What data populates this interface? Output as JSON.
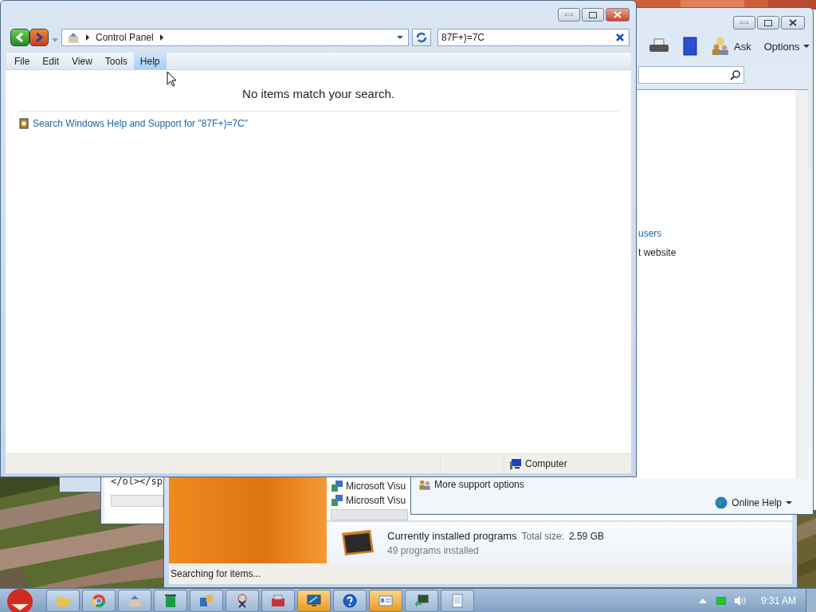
{
  "main_window": {
    "address": [
      "Control Panel"
    ],
    "search_value": "87F+)=7C",
    "menu": [
      {
        "label": "File",
        "selected": false
      },
      {
        "label": "Edit",
        "selected": false
      },
      {
        "label": "View",
        "selected": false
      },
      {
        "label": "Tools",
        "selected": false
      },
      {
        "label": "Help",
        "selected": true
      }
    ],
    "message": "No items match your search.",
    "help_link": "Search Windows Help and Support for \"87F+)=7C\"",
    "status": "Computer"
  },
  "help_window": {
    "toolbar": [
      "Ask",
      "Options"
    ],
    "links": [
      {
        "text": "users",
        "kind": "link"
      },
      {
        "text": "t website",
        "kind": "plain"
      }
    ],
    "more_support": "More support options",
    "online_help": "Online Help"
  },
  "code_window": {
    "lines": [
      "</ol></sp"
    ]
  },
  "programs_window": {
    "list": [
      "Microsoft Visu",
      "Microsoft Visu"
    ],
    "title": "Currently installed programs",
    "size_label": "Total size:",
    "size_value": "2.59 GB",
    "count": "49 programs installed",
    "status": "Searching for items..."
  },
  "taskbar": {
    "items": [
      {
        "kind": "folder",
        "active": false
      },
      {
        "kind": "browser",
        "active": false
      },
      {
        "kind": "control",
        "active": false
      },
      {
        "kind": "bin",
        "active": false
      },
      {
        "kind": "app",
        "active": false
      },
      {
        "kind": "tools",
        "active": false
      },
      {
        "kind": "toolbox",
        "active": false
      },
      {
        "kind": "monitor",
        "active": true
      },
      {
        "kind": "help",
        "active": false
      },
      {
        "kind": "card",
        "active": true
      },
      {
        "kind": "network",
        "active": false
      },
      {
        "kind": "notepad",
        "active": false
      }
    ],
    "clock": "9:31 AM"
  }
}
